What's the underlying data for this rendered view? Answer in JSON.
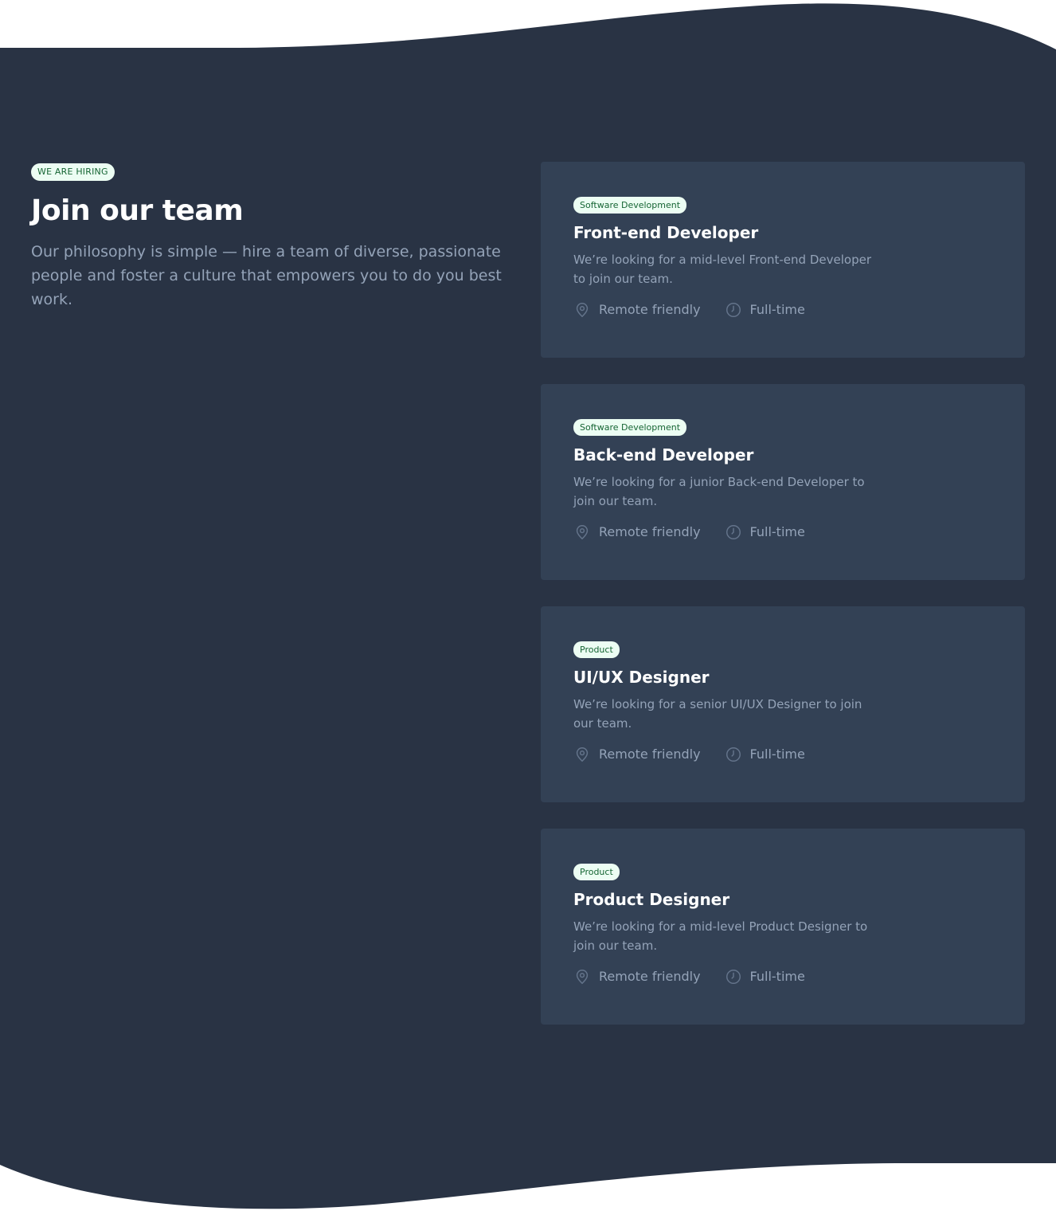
{
  "colors": {
    "section_background": "#293344",
    "card_background": "#334155",
    "badge_background": "#ecfdf3",
    "badge_text": "#166534",
    "heading": "#ffffff",
    "body_text": "#94a3b8",
    "icon": "#64748b"
  },
  "intro": {
    "badge": "WE ARE HIRING",
    "title": "Join our team",
    "description": "Our philosophy is simple — hire a team of diverse, passionate people and foster a culture that empowers you to do you best work."
  },
  "jobs": [
    {
      "category": "Software Development",
      "title": "Front-end Developer",
      "description": "We’re looking for a mid-level Front-end Developer to join our team.",
      "location": "Remote friendly",
      "location_icon": "map-pin-icon",
      "type": "Full-time",
      "type_icon": "clock-icon"
    },
    {
      "category": "Software Development",
      "title": "Back-end Developer",
      "description": "We’re looking for a junior Back-end Developer to join our team.",
      "location": "Remote friendly",
      "location_icon": "map-pin-icon",
      "type": "Full-time",
      "type_icon": "clock-icon"
    },
    {
      "category": "Product",
      "title": "UI/UX Designer",
      "description": "We’re looking for a senior UI/UX Designer to join our team.",
      "location": "Remote friendly",
      "location_icon": "map-pin-icon",
      "type": "Full-time",
      "type_icon": "clock-icon"
    },
    {
      "category": "Product",
      "title": "Product Designer",
      "description": "We’re looking for a mid-level Product Designer to join our team.",
      "location": "Remote friendly",
      "location_icon": "map-pin-icon",
      "type": "Full-time",
      "type_icon": "clock-icon"
    }
  ]
}
